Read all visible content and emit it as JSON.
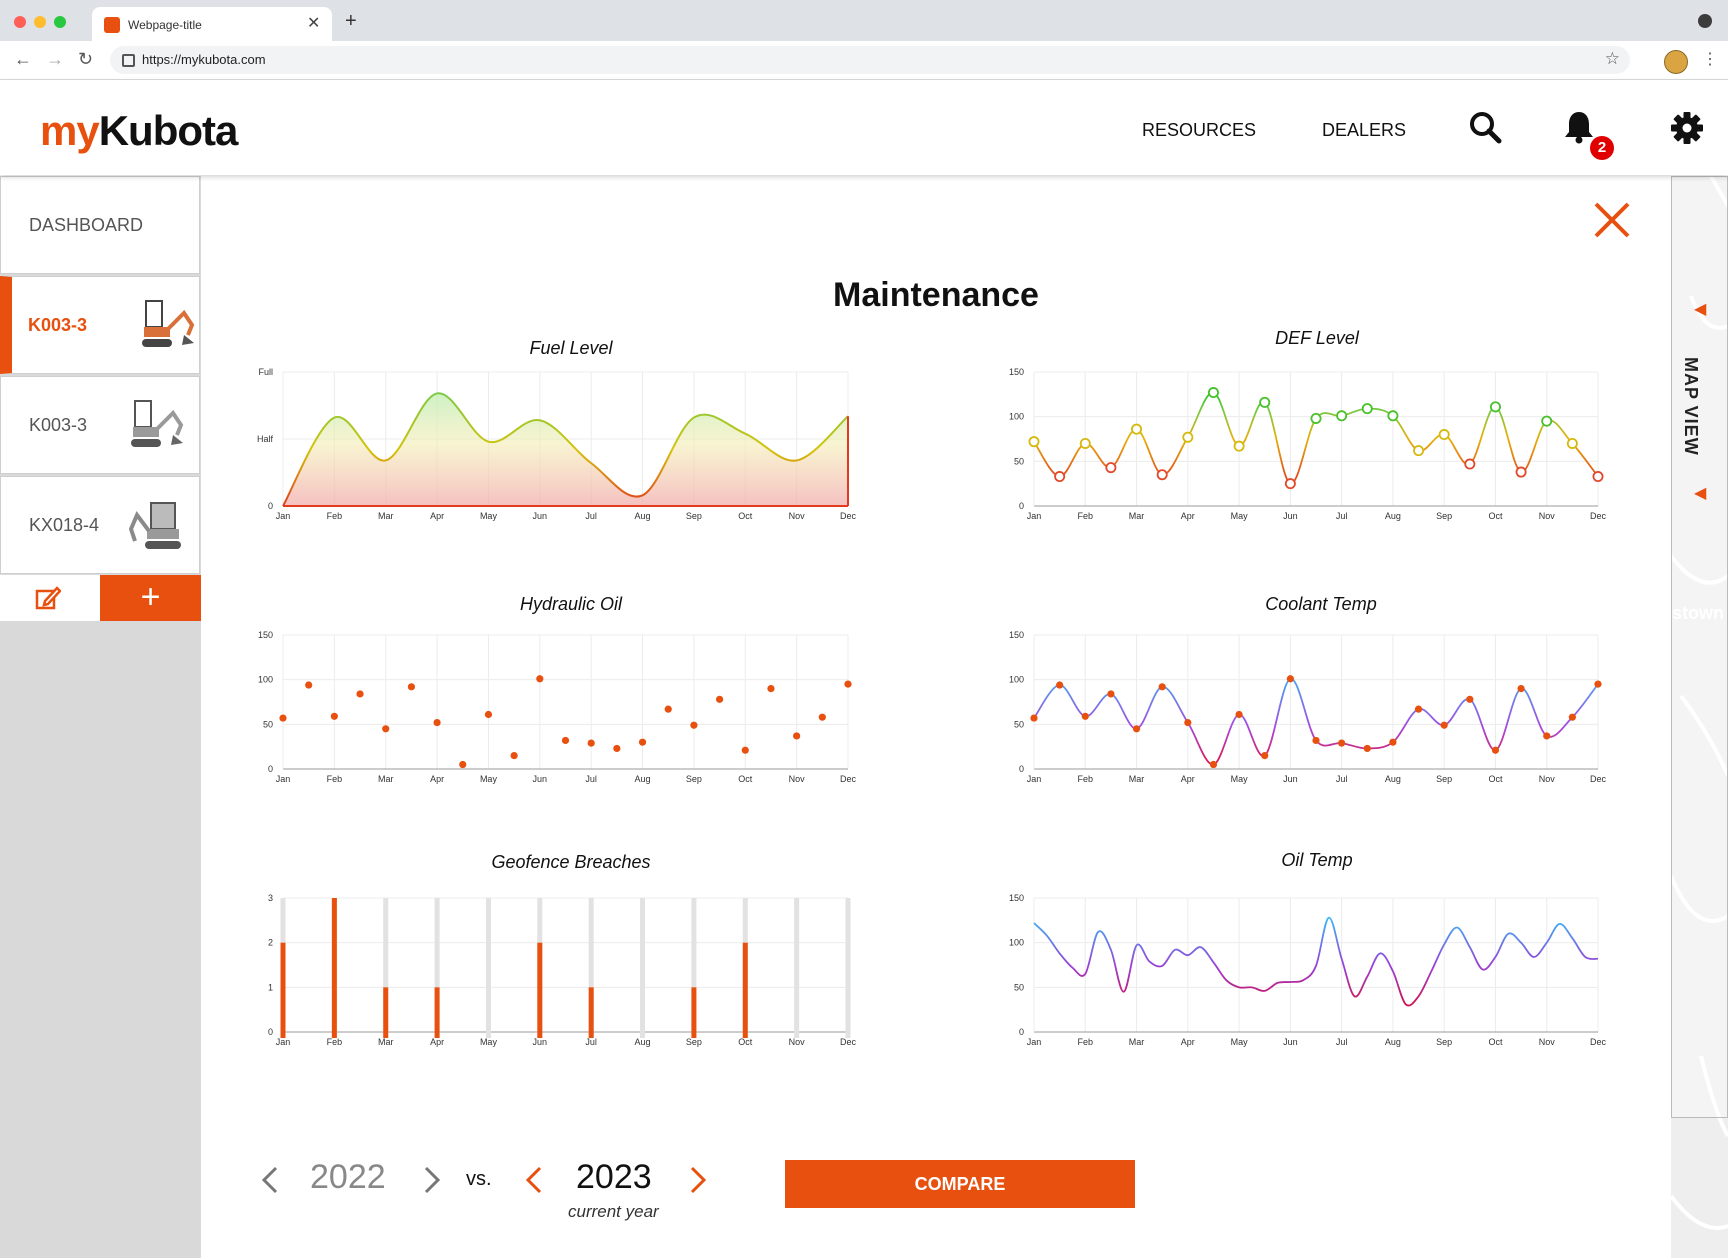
{
  "browser": {
    "tab_title": "Webpage-title",
    "url": "https://mykubota.com"
  },
  "header": {
    "logo_my": "my",
    "logo_kubota": "Kubota",
    "nav_resources": "RESOURCES",
    "nav_dealers": "DEALERS",
    "notification_count": "2"
  },
  "sidebar": {
    "dashboard": "DASHBOARD",
    "machines": [
      "K003-3",
      "K003-3",
      "KX018-4"
    ],
    "add_label": "+"
  },
  "map": {
    "label": "MAP VIEW",
    "town_fragment": "stown"
  },
  "page": {
    "title": "Maintenance"
  },
  "footer": {
    "year_a": "2022",
    "vs": "vs.",
    "year_b": "2023",
    "year_b_note": "current year",
    "compare": "COMPARE"
  },
  "colors": {
    "accent": "#e8500f",
    "fuel_high": "#7ac943",
    "fuel_low": "#e23b1f",
    "coolant_high": "#4aa8f0",
    "coolant_low": "#e0154d",
    "oil_high": "#39b8f5",
    "oil_low": "#d2114a"
  },
  "chart_data": [
    {
      "id": "fuel",
      "type": "area",
      "title": "Fuel Level",
      "categories": [
        "Jan",
        "Feb",
        "Mar",
        "Apr",
        "May",
        "Jun",
        "Jul",
        "Aug",
        "Sep",
        "Oct",
        "Nov",
        "Dec"
      ],
      "y_tick_labels": [
        "0",
        "Half",
        "Full"
      ],
      "y_ticks": [
        0,
        50,
        100
      ],
      "ylim": [
        0,
        100
      ],
      "x": [
        0,
        1,
        2,
        3,
        4,
        5,
        6,
        7,
        8,
        9,
        10,
        11
      ],
      "values": [
        0,
        66,
        34,
        84,
        48,
        64,
        32,
        8,
        66,
        54,
        34,
        67
      ]
    },
    {
      "id": "def",
      "type": "line",
      "title": "DEF Level",
      "categories": [
        "Jan",
        "Feb",
        "Mar",
        "Apr",
        "May",
        "Jun",
        "Jul",
        "Aug",
        "Sep",
        "Oct",
        "Nov",
        "Dec"
      ],
      "y_ticks": [
        0,
        50,
        100,
        150
      ],
      "ylim": [
        0,
        150
      ],
      "x": [
        0,
        0.5,
        1,
        1.5,
        2,
        2.5,
        3,
        3.5,
        4,
        4.5,
        5,
        5.5,
        6,
        6.5,
        7,
        7.5,
        8,
        8.5,
        9,
        9.5,
        10,
        10.5,
        11
      ],
      "values": [
        72,
        33,
        70,
        43,
        86,
        35,
        77,
        127,
        67,
        116,
        25,
        98,
        101,
        109,
        101,
        62,
        80,
        47,
        111,
        38,
        95,
        70,
        33
      ],
      "markers": true
    },
    {
      "id": "hydraulic",
      "type": "scatter",
      "title": "Hydraulic Oil",
      "categories": [
        "Jan",
        "Feb",
        "Mar",
        "Apr",
        "May",
        "Jun",
        "Jul",
        "Aug",
        "Sep",
        "Oct",
        "Nov",
        "Dec"
      ],
      "y_ticks": [
        0,
        50,
        100,
        150
      ],
      "ylim": [
        0,
        150
      ],
      "x": [
        0,
        0.5,
        1,
        1.5,
        2,
        2.5,
        3,
        3.5,
        4,
        4.5,
        5,
        5.5,
        6,
        6.5,
        7,
        7.5,
        8,
        8.5,
        9,
        9.5,
        10,
        10.5,
        11
      ],
      "values": [
        57,
        94,
        59,
        84,
        45,
        92,
        52,
        5,
        61,
        15,
        101,
        32,
        29,
        23,
        30,
        67,
        49,
        78,
        21,
        90,
        37,
        58,
        95
      ]
    },
    {
      "id": "coolant",
      "type": "line",
      "title": "Coolant Temp",
      "categories": [
        "Jan",
        "Feb",
        "Mar",
        "Apr",
        "May",
        "Jun",
        "Jul",
        "Aug",
        "Sep",
        "Oct",
        "Nov",
        "Dec"
      ],
      "y_ticks": [
        0,
        50,
        100,
        150
      ],
      "ylim": [
        0,
        150
      ],
      "x": [
        0,
        0.5,
        1,
        1.5,
        2,
        2.5,
        3,
        3.5,
        4,
        4.5,
        5,
        5.5,
        6,
        6.5,
        7,
        7.5,
        8,
        8.5,
        9,
        9.5,
        10,
        10.5,
        11
      ],
      "values": [
        57,
        94,
        59,
        84,
        45,
        92,
        52,
        5,
        61,
        15,
        101,
        32,
        29,
        23,
        30,
        67,
        49,
        78,
        21,
        90,
        37,
        58,
        95
      ],
      "markers": true
    },
    {
      "id": "geofence",
      "type": "bar",
      "title": "Geofence Breaches",
      "categories": [
        "Jan",
        "Feb",
        "Mar",
        "Apr",
        "May",
        "Jun",
        "Jul",
        "Aug",
        "Sep",
        "Oct",
        "Nov",
        "Dec"
      ],
      "y_ticks": [
        0,
        1,
        2,
        3
      ],
      "ylim": [
        0,
        3
      ],
      "values": [
        2,
        3,
        1,
        1,
        0,
        2,
        1,
        0,
        1,
        2,
        0,
        0
      ]
    },
    {
      "id": "oiltemp",
      "type": "line",
      "title": "Oil Temp",
      "categories": [
        "Jan",
        "Feb",
        "Mar",
        "Apr",
        "May",
        "Jun",
        "Jul",
        "Aug",
        "Sep",
        "Oct",
        "Nov",
        "Dec"
      ],
      "y_ticks": [
        0,
        50,
        100,
        150
      ],
      "ylim": [
        0,
        150
      ],
      "x": [
        0,
        0.25,
        0.5,
        0.75,
        1,
        1.25,
        1.5,
        1.75,
        2,
        2.25,
        2.5,
        2.75,
        3,
        3.25,
        3.5,
        3.75,
        4,
        4.25,
        4.5,
        4.75,
        5,
        5.25,
        5.5,
        5.75,
        6,
        6.25,
        6.5,
        6.75,
        7,
        7.25,
        7.5,
        7.75,
        8,
        8.25,
        8.5,
        8.75,
        9,
        9.25,
        9.5,
        9.75,
        10,
        10.25,
        10.5,
        10.75,
        11
      ],
      "values": [
        122,
        108,
        88,
        72,
        65,
        112,
        92,
        45,
        97,
        79,
        74,
        92,
        86,
        95,
        78,
        58,
        50,
        50,
        46,
        55,
        56,
        58,
        74,
        128,
        82,
        40,
        62,
        88,
        68,
        31,
        40,
        68,
        98,
        117,
        95,
        70,
        84,
        110,
        100,
        84,
        100,
        121,
        105,
        84,
        82
      ]
    }
  ]
}
